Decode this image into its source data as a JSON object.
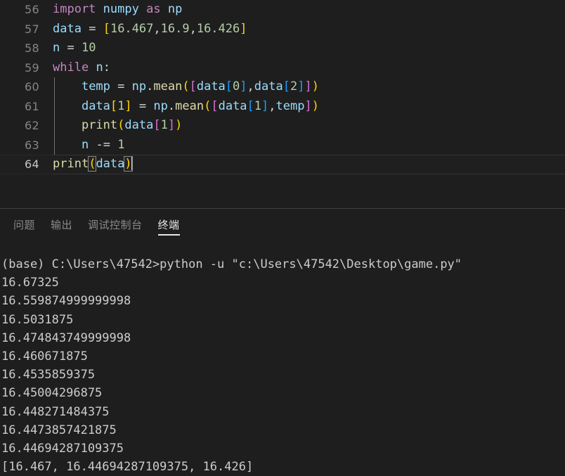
{
  "editor": {
    "language": "python",
    "first_line_number": 56,
    "active_line_number": 64,
    "lines": [
      {
        "number": "56",
        "text": "import numpy as np"
      },
      {
        "number": "57",
        "text": "data = [16.467,16.9,16.426]"
      },
      {
        "number": "58",
        "text": "n = 10"
      },
      {
        "number": "59",
        "text": "while n:"
      },
      {
        "number": "60",
        "text": "    temp = np.mean([data[0],data[2]])"
      },
      {
        "number": "61",
        "text": "    data[1] = np.mean([data[1],temp])"
      },
      {
        "number": "62",
        "text": "    print(data[1])"
      },
      {
        "number": "63",
        "text": "    n -= 1"
      },
      {
        "number": "64",
        "text": "print(data)"
      }
    ],
    "tokens": {
      "l56": [
        {
          "t": "import",
          "c": "t-kw"
        },
        {
          "t": " ",
          "c": "t-pl"
        },
        {
          "t": "numpy",
          "c": "t-var"
        },
        {
          "t": " ",
          "c": "t-pl"
        },
        {
          "t": "as",
          "c": "t-kw"
        },
        {
          "t": " ",
          "c": "t-pl"
        },
        {
          "t": "np",
          "c": "t-var"
        }
      ],
      "l57": [
        {
          "t": "data",
          "c": "t-var"
        },
        {
          "t": " ",
          "c": "t-pl"
        },
        {
          "t": "=",
          "c": "t-op"
        },
        {
          "t": " ",
          "c": "t-pl"
        },
        {
          "t": "[",
          "c": "t-b1"
        },
        {
          "t": "16.467",
          "c": "t-num"
        },
        {
          "t": ",",
          "c": "t-op"
        },
        {
          "t": "16.9",
          "c": "t-num"
        },
        {
          "t": ",",
          "c": "t-op"
        },
        {
          "t": "16.426",
          "c": "t-num"
        },
        {
          "t": "]",
          "c": "t-b1"
        }
      ],
      "l58": [
        {
          "t": "n",
          "c": "t-var"
        },
        {
          "t": " ",
          "c": "t-pl"
        },
        {
          "t": "=",
          "c": "t-op"
        },
        {
          "t": " ",
          "c": "t-pl"
        },
        {
          "t": "10",
          "c": "t-num"
        }
      ],
      "l59": [
        {
          "t": "while",
          "c": "t-kw"
        },
        {
          "t": " ",
          "c": "t-pl"
        },
        {
          "t": "n",
          "c": "t-var"
        },
        {
          "t": ":",
          "c": "t-op"
        }
      ],
      "l60": [
        {
          "t": "    ",
          "c": "t-pl"
        },
        {
          "t": "temp",
          "c": "t-var"
        },
        {
          "t": " ",
          "c": "t-pl"
        },
        {
          "t": "=",
          "c": "t-op"
        },
        {
          "t": " ",
          "c": "t-pl"
        },
        {
          "t": "np",
          "c": "t-var"
        },
        {
          "t": ".",
          "c": "t-op"
        },
        {
          "t": "mean",
          "c": "t-fn"
        },
        {
          "t": "(",
          "c": "t-b1"
        },
        {
          "t": "[",
          "c": "t-b2"
        },
        {
          "t": "data",
          "c": "t-var"
        },
        {
          "t": "[",
          "c": "t-b3"
        },
        {
          "t": "0",
          "c": "t-num"
        },
        {
          "t": "]",
          "c": "t-b3"
        },
        {
          "t": ",",
          "c": "t-op"
        },
        {
          "t": "data",
          "c": "t-var"
        },
        {
          "t": "[",
          "c": "t-b3"
        },
        {
          "t": "2",
          "c": "t-num"
        },
        {
          "t": "]",
          "c": "t-b3"
        },
        {
          "t": "]",
          "c": "t-b2"
        },
        {
          "t": ")",
          "c": "t-b1"
        }
      ],
      "l61": [
        {
          "t": "    ",
          "c": "t-pl"
        },
        {
          "t": "data",
          "c": "t-var"
        },
        {
          "t": "[",
          "c": "t-b1"
        },
        {
          "t": "1",
          "c": "t-num"
        },
        {
          "t": "]",
          "c": "t-b1"
        },
        {
          "t": " ",
          "c": "t-pl"
        },
        {
          "t": "=",
          "c": "t-op"
        },
        {
          "t": " ",
          "c": "t-pl"
        },
        {
          "t": "np",
          "c": "t-var"
        },
        {
          "t": ".",
          "c": "t-op"
        },
        {
          "t": "mean",
          "c": "t-fn"
        },
        {
          "t": "(",
          "c": "t-b1"
        },
        {
          "t": "[",
          "c": "t-b2"
        },
        {
          "t": "data",
          "c": "t-var"
        },
        {
          "t": "[",
          "c": "t-b3"
        },
        {
          "t": "1",
          "c": "t-num"
        },
        {
          "t": "]",
          "c": "t-b3"
        },
        {
          "t": ",",
          "c": "t-op"
        },
        {
          "t": "temp",
          "c": "t-var"
        },
        {
          "t": "]",
          "c": "t-b2"
        },
        {
          "t": ")",
          "c": "t-b1"
        }
      ],
      "l62": [
        {
          "t": "    ",
          "c": "t-pl"
        },
        {
          "t": "print",
          "c": "t-fn"
        },
        {
          "t": "(",
          "c": "t-b1"
        },
        {
          "t": "data",
          "c": "t-var"
        },
        {
          "t": "[",
          "c": "t-b2"
        },
        {
          "t": "1",
          "c": "t-num"
        },
        {
          "t": "]",
          "c": "t-b2"
        },
        {
          "t": ")",
          "c": "t-b1"
        }
      ],
      "l63": [
        {
          "t": "    ",
          "c": "t-pl"
        },
        {
          "t": "n",
          "c": "t-var"
        },
        {
          "t": " ",
          "c": "t-pl"
        },
        {
          "t": "-=",
          "c": "t-op"
        },
        {
          "t": " ",
          "c": "t-pl"
        },
        {
          "t": "1",
          "c": "t-num"
        }
      ],
      "l64": [
        {
          "t": "print",
          "c": "t-fn"
        },
        {
          "t": "(",
          "c": "t-b1 brk-match"
        },
        {
          "t": "data",
          "c": "t-var"
        },
        {
          "t": ")",
          "c": "t-b1 brk-match"
        }
      ]
    }
  },
  "panel": {
    "tabs": [
      {
        "label": "问题",
        "active": false
      },
      {
        "label": "输出",
        "active": false
      },
      {
        "label": "调试控制台",
        "active": false
      },
      {
        "label": "终端",
        "active": true
      }
    ]
  },
  "terminal": {
    "prompt_line": "(base) C:\\Users\\47542>python -u \"c:\\Users\\47542\\Desktop\\game.py\"",
    "lines": [
      "(base) C:\\Users\\47542>python -u \"c:\\Users\\47542\\Desktop\\game.py\"",
      "16.67325",
      "16.559874999999998",
      "16.5031875",
      "16.474843749999998",
      "16.460671875",
      "16.4535859375",
      "16.45004296875",
      "16.448271484375",
      "16.4473857421875",
      "16.44694287109375",
      "[16.467, 16.44694287109375, 16.426]"
    ]
  },
  "colors": {
    "background": "#1e1e1e",
    "line_number": "#858585",
    "keyword": "#c586c0",
    "variable": "#9cdcfe",
    "function": "#dcdcaa",
    "number": "#b5cea8",
    "plain": "#d4d4d4",
    "bracket_level1": "#ffd700",
    "bracket_level2": "#da70d6",
    "bracket_level3": "#179fff",
    "terminal_text": "#cccccc",
    "separator": "#414141",
    "tab_inactive": "#8a8a8a",
    "tab_active": "#e7e7e7"
  }
}
